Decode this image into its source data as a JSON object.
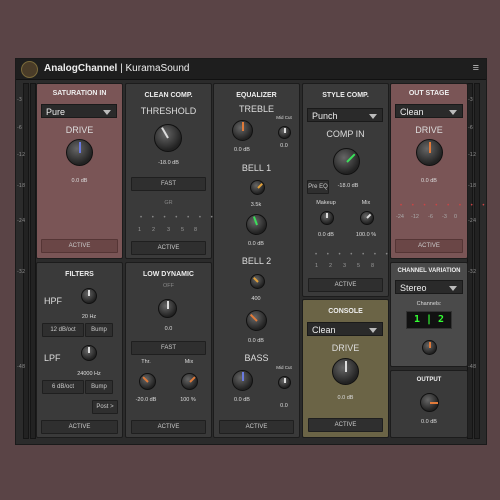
{
  "header": {
    "app_name": "AnalogChannel",
    "separator": "|",
    "vendor": "KuramaSound",
    "menu_icon": "menu-icon"
  },
  "meters": {
    "scale": [
      "-3",
      "-6",
      "-12",
      "-18",
      "-24",
      "-32",
      "-48"
    ]
  },
  "saturation": {
    "title": "SATURATION IN",
    "mode": "Pure",
    "knob_label": "DRIVE",
    "value": "0.0 dB",
    "active": "ACTIVE"
  },
  "filters": {
    "title": "FILTERS",
    "hpf_label": "HPF",
    "hpf_value": "20 Hz",
    "hpf_slope": "12 dB/oct",
    "hpf_bump": "Bump",
    "lpf_label": "LPF",
    "lpf_value": "24000 Hz",
    "lpf_slope": "6 dB/oct",
    "lpf_bump": "Bump",
    "post": "Post >",
    "active": "ACTIVE"
  },
  "clean_comp": {
    "title": "CLEAN COMP.",
    "knob_label": "THRESHOLD",
    "value": "-18.0 dB",
    "speed": "FAST",
    "gr_label": "GR",
    "gr_scale": [
      "1",
      "2",
      "3",
      "5",
      "8"
    ],
    "active": "ACTIVE"
  },
  "low_dynamic": {
    "title": "LOW DYNAMIC",
    "state": "OFF",
    "value": "0.0",
    "speed": "FAST",
    "thr_label": "Thr.",
    "thr_value": "-20.0 dB",
    "mix_label": "Mix",
    "mix_value": "100 %",
    "active": "ACTIVE"
  },
  "equalizer": {
    "title": "EQUALIZER",
    "treble_label": "TREBLE",
    "treble_value": "0.0 dB",
    "midcut_label": "Mid Cut",
    "treble_midcut_value": "0.0",
    "bell1_label": "BELL 1",
    "bell1_freq": "3.5k",
    "bell1_value": "0.0 dB",
    "bell2_label": "BELL 2",
    "bell2_freq": "400",
    "bell2_value": "0.0 dB",
    "bass_label": "BASS",
    "bass_value": "0.0 dB",
    "bass_midcut_label": "Mid Cut",
    "bass_midcut_value": "0.0",
    "active": "ACTIVE"
  },
  "style_comp": {
    "title": "STYLE COMP.",
    "mode": "Punch",
    "knob_label": "COMP IN",
    "pre_eq": "Pre EQ",
    "value": "-18.0 dB",
    "makeup_label": "Makeup",
    "makeup_value": "0.0 dB",
    "mix_label": "Mix",
    "mix_value": "100.0 %",
    "gr_scale": [
      "1",
      "2",
      "3",
      "5",
      "8"
    ],
    "active": "ACTIVE"
  },
  "console": {
    "title": "CONSOLE",
    "mode": "Clean",
    "knob_label": "DRIVE",
    "value": "0.0 dB",
    "active": "ACTIVE"
  },
  "out_stage": {
    "title": "OUT STAGE",
    "mode": "Clean",
    "knob_label": "DRIVE",
    "value": "0.0 dB",
    "scale": [
      "-24",
      "-12",
      "-6",
      "-3",
      "0"
    ],
    "active": "ACTIVE"
  },
  "channel_variation": {
    "title": "CHANNEL VARIATION",
    "mode": "Stereo",
    "channels_label": "Channels:",
    "channels_value": "1 | 2"
  },
  "output": {
    "title": "OUTPUT",
    "value": "0.0 dB"
  }
}
